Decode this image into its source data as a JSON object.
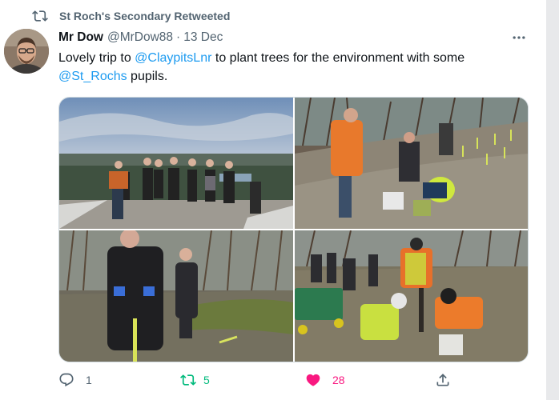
{
  "retweet_notice": {
    "icon": "retweet-icon",
    "text": "St Roch's Secondary Retweeted"
  },
  "author": {
    "name": "Mr Dow",
    "handle": "@MrDow88",
    "separator": "·",
    "date": "13 Dec",
    "avatar": "avatar-photo"
  },
  "tweet": {
    "text_part1": "Lovely trip to ",
    "mention1": "@ClaypitsLnr",
    "text_part2": " to plant trees for the environment with some ",
    "mention2": "@St_Rochs",
    "text_part3": " pupils."
  },
  "media": {
    "photos": [
      {
        "name": "group-photo-overlook"
      },
      {
        "name": "planting-photo-hillside"
      },
      {
        "name": "teacher-and-pupil-photo"
      },
      {
        "name": "planting-photo-wheelbarrow"
      }
    ]
  },
  "actions": {
    "reply": {
      "icon": "reply-icon",
      "count": "1"
    },
    "retweet": {
      "icon": "retweet-icon",
      "count": "5",
      "active_color": "#00ba7c"
    },
    "like": {
      "icon": "heart-icon",
      "count": "28",
      "active_color": "#f91880"
    },
    "share": {
      "icon": "share-icon"
    }
  },
  "colors": {
    "link": "#1d9bf0",
    "secondary_text": "#536471",
    "primary_text": "#0f1419"
  }
}
